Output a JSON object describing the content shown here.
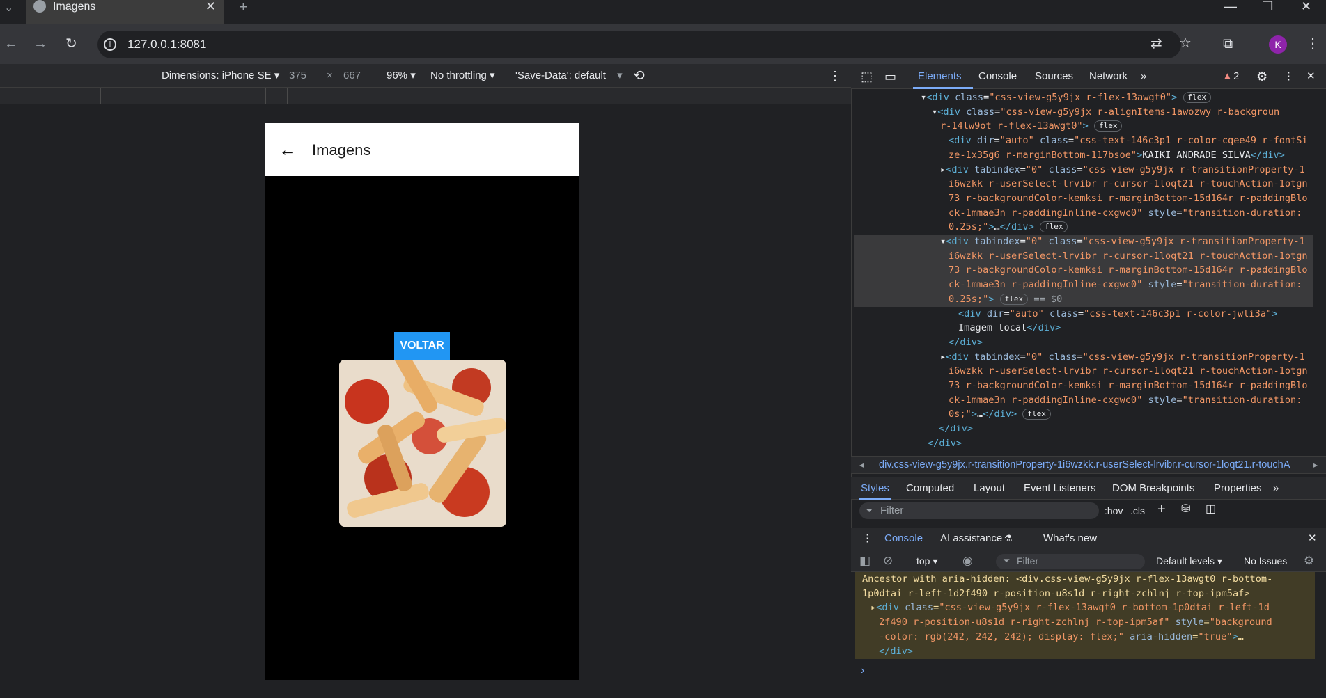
{
  "browser": {
    "tab_title": "Imagens",
    "url": "127.0.0.1:8081",
    "profile_initial": "K"
  },
  "device_toolbar": {
    "dimensions_label": "Dimensions: iPhone SE",
    "width": "375",
    "times": "×",
    "height": "667",
    "zoom": "96%",
    "throttling": "No throttling",
    "save_data": "'Save-Data': default"
  },
  "app": {
    "title": "Imagens",
    "button_label": "VOLTAR"
  },
  "devtools": {
    "tabs": [
      "Elements",
      "Console",
      "Sources",
      "Network"
    ],
    "warning_count": "2",
    "breadcrumb": "div.css-view-g5y9jx.r-transitionProperty-1i6wzkk.r-userSelect-lrvibr.r-cursor-1loqt21.r-touchA",
    "style_tabs": [
      "Styles",
      "Computed",
      "Layout",
      "Event Listeners",
      "DOM Breakpoints",
      "Properties"
    ],
    "filter_placeholder": "Filter",
    "hov": ":hov",
    "cls": ".cls",
    "drawer_tabs": [
      "Console",
      "AI assistance",
      "What's new"
    ],
    "console_context": "top",
    "console_filter": "Filter",
    "default_levels": "Default levels",
    "no_issues": "No Issues",
    "tree_text": {
      "student_name": "KAIKI ANDRADE SILVA",
      "image_label": "Imagem local",
      "selected_marker": "== $0",
      "flex_badge": "flex"
    },
    "warning_lines": [
      "Ancestor with aria-hidden: <div.css-view-g5y9jx r-flex-13awgt0 r-bottom-",
      "1p0dtai r-left-1d2f490 r-position-u8s1d r-right-zchlnj r-top-ipm5af>"
    ]
  }
}
